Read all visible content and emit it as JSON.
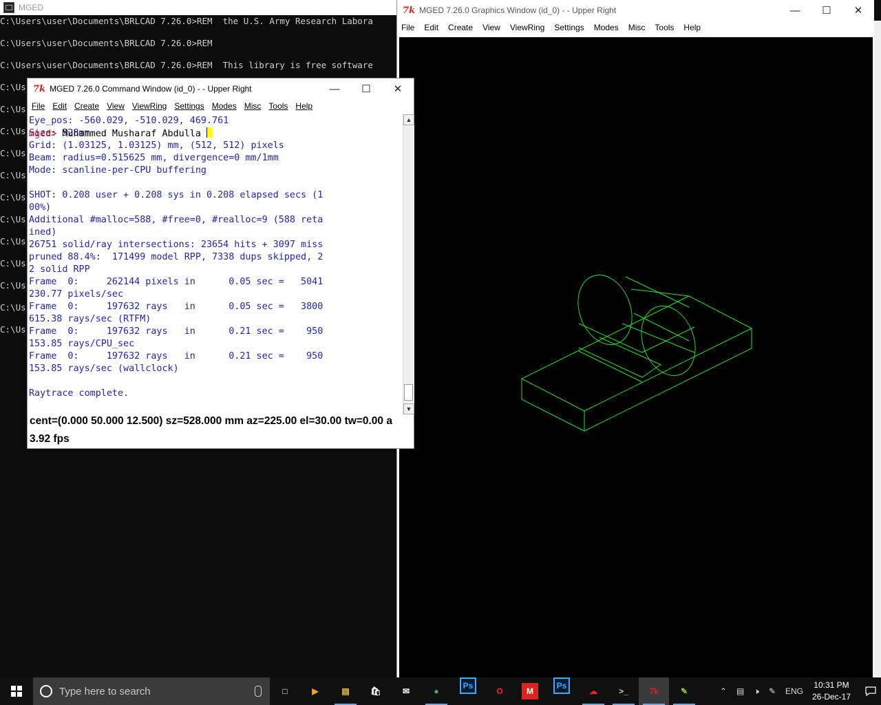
{
  "console": {
    "title": "MGED",
    "lines": [
      "C:\\Users\\user\\Documents\\BRLCAD 7.26.0>REM  the U.S. Army Research Labora",
      "",
      "C:\\Users\\user\\Documents\\BRLCAD 7.26.0>REM",
      "",
      "C:\\Users\\user\\Documents\\BRLCAD 7.26.0>REM  This library is free software",
      "",
      "C:\\Us",
      "",
      "C:\\Us",
      "",
      "C:\\Us",
      "",
      "C:\\Us",
      "",
      "C:\\Us",
      "",
      "C:\\Us",
      "",
      "C:\\Us",
      "",
      "C:\\Us",
      "",
      "C:\\Us",
      "",
      "C:\\Us",
      "",
      "C:\\Us",
      "",
      "C:\\Us"
    ]
  },
  "command_window": {
    "title": "MGED 7.26.0 Command Window (id_0) -  - Upper Right",
    "menu": [
      "File",
      "Edit",
      "Create",
      "View",
      "ViewRing",
      "Settings",
      "Modes",
      "Misc",
      "Tools",
      "Help"
    ],
    "lines": [
      "Eye_pos: -560.029, -510.029, 469.761",
      "Size: 528mm",
      "Grid: (1.03125, 1.03125) mm, (512, 512) pixels",
      "Beam: radius=0.515625 mm, divergence=0 mm/1mm",
      "Mode: scanline-per-CPU buffering",
      "",
      "SHOT: 0.208 user + 0.208 sys in 0.208 elapsed secs (1",
      "00%)",
      "Additional #malloc=588, #free=0, #realloc=9 (588 reta",
      "ined)",
      "26751 solid/ray intersections: 23654 hits + 3097 miss",
      "pruned 88.4%:  171499 model RPP, 7338 dups skipped, 2",
      "2 solid RPP",
      "Frame  0:     262144 pixels in      0.05 sec =   5041",
      "230.77 pixels/sec",
      "Frame  0:     197632 rays   in      0.05 sec =   3800",
      "615.38 rays/sec (RTFM)",
      "Frame  0:     197632 rays   in      0.21 sec =    950",
      "153.85 rays/CPU_sec",
      "Frame  0:     197632 rays   in      0.21 sec =    950",
      "153.85 rays/sec (wallclock)",
      "",
      "Raytrace complete."
    ],
    "prompt": "mged>",
    "input": "Muhammed Musharaf Abdulla ",
    "status_line1": "cent=(0.000 50.000 12.500) sz=528.000  mm  az=225.00  el=30.00  tw=0.00  a",
    "status_line2": "3.92 fps"
  },
  "graphics_window": {
    "title": "MGED 7.26.0 Graphics Window (id_0) -  - Upper Right",
    "menu": [
      "File",
      "Edit",
      "Create",
      "View",
      "ViewRing",
      "Settings",
      "Modes",
      "Misc",
      "Tools",
      "Help"
    ],
    "wireframe_color": "#22e622"
  },
  "taskbar": {
    "search_placeholder": "Type here to search",
    "apps": [
      "task-view-icon",
      "media-player-icon",
      "file-explorer-icon",
      "store-icon",
      "mail-icon",
      "chrome-icon",
      "photoshop-icon",
      "opera-icon",
      "m-app-icon",
      "photoshop-icon",
      "creative-cloud-icon",
      "console-icon",
      "mged-icon",
      "paint-icon"
    ],
    "language": "ENG",
    "time": "10:31 PM",
    "date": "26-Dec-17"
  }
}
